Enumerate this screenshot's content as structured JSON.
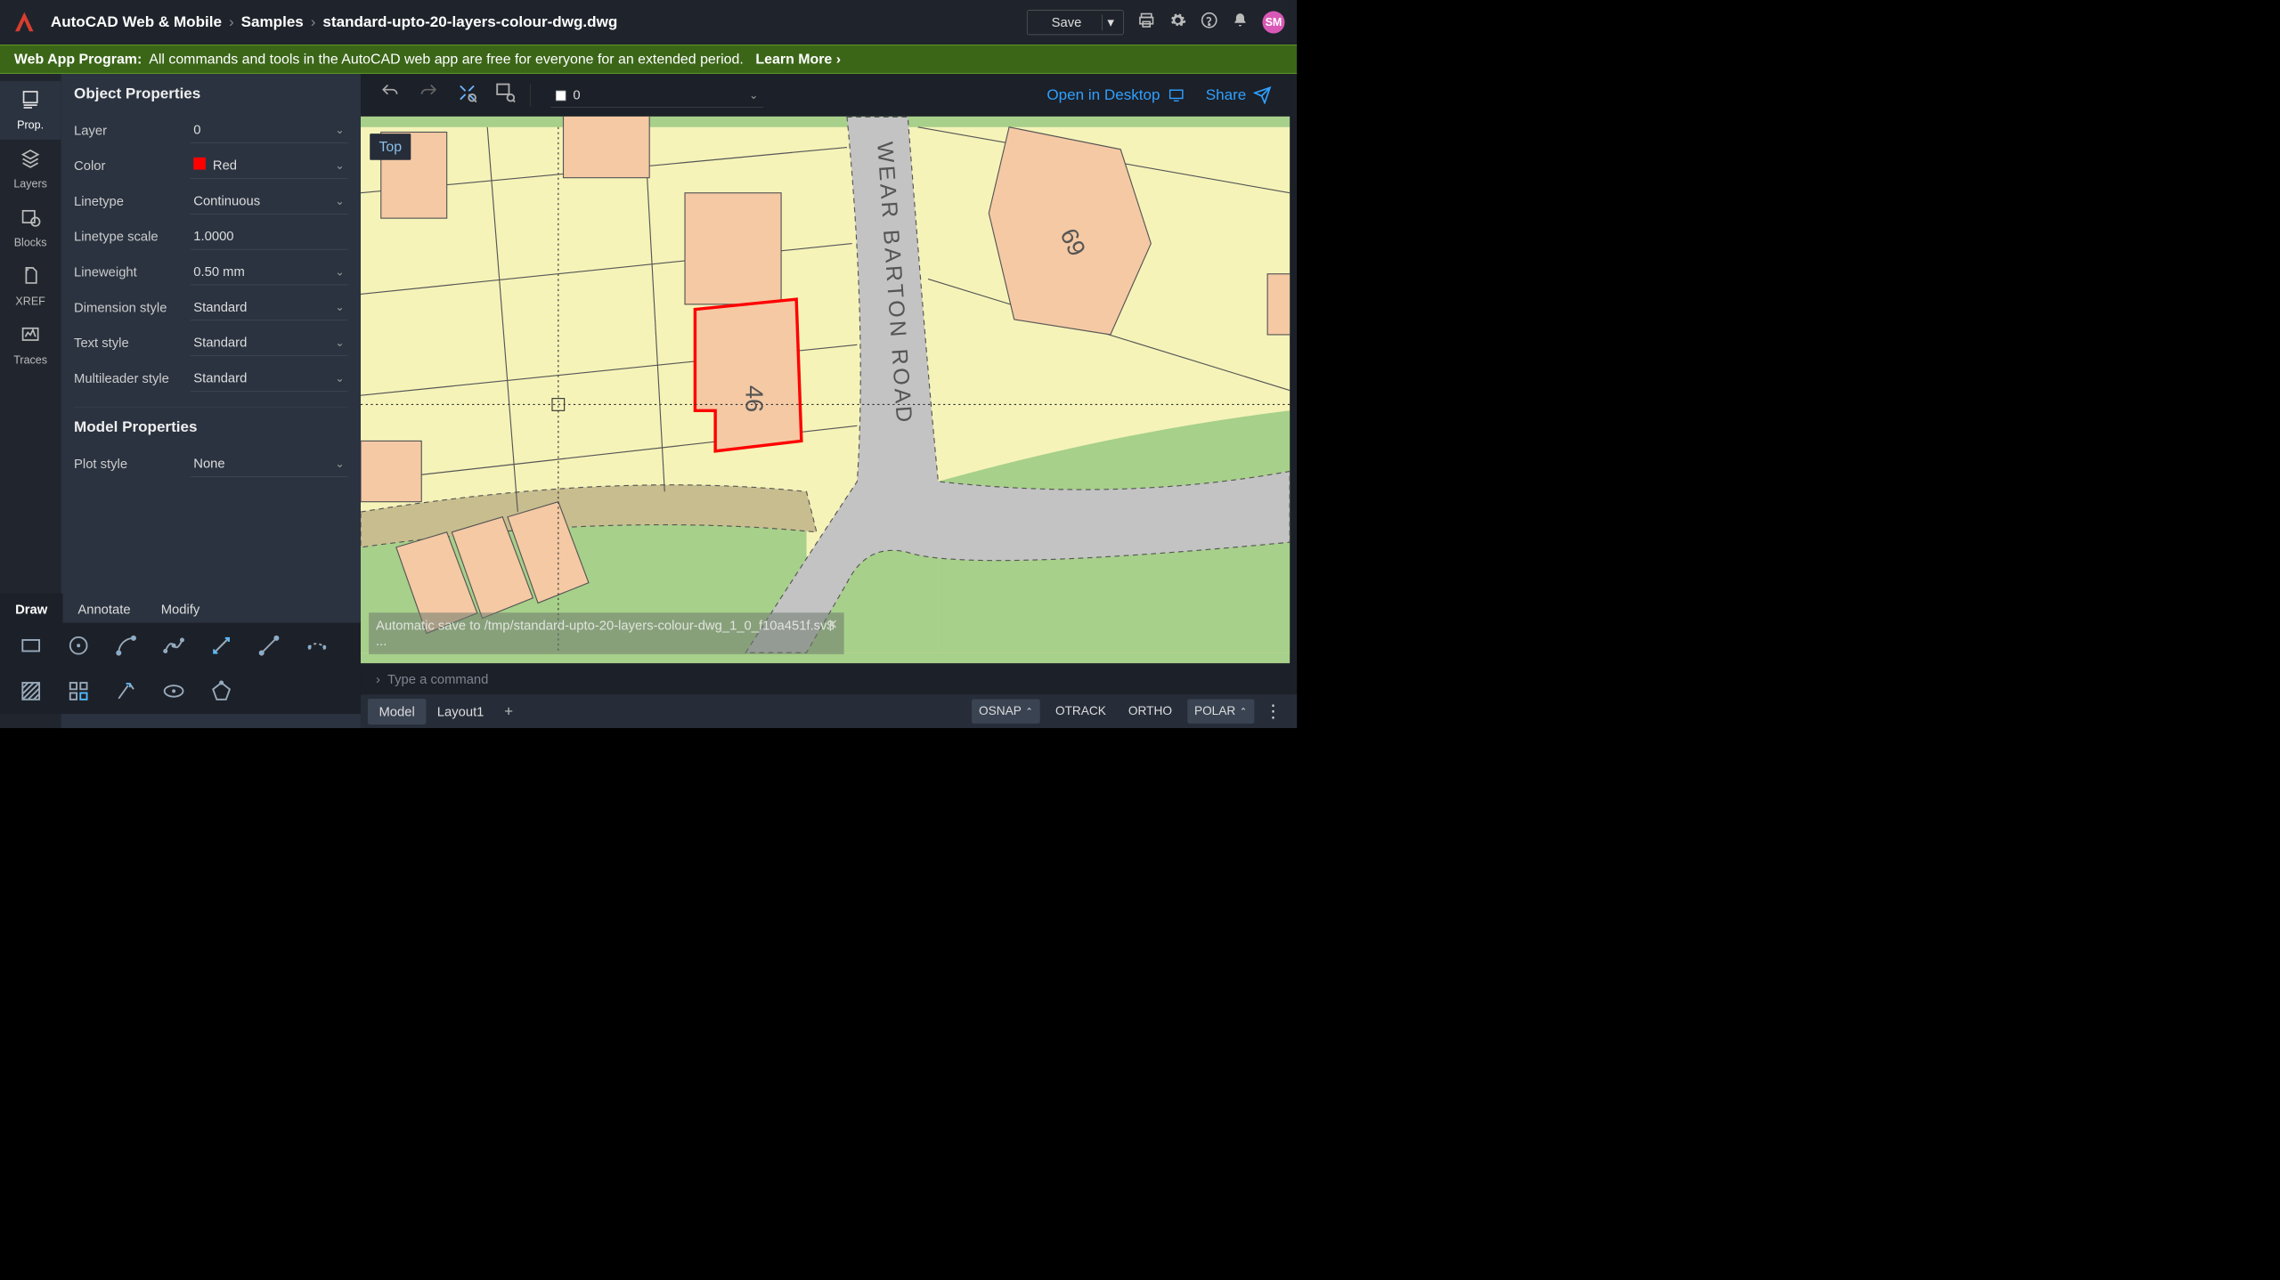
{
  "app": {
    "name": "AutoCAD Web & Mobile"
  },
  "breadcrumb": {
    "root": "AutoCAD Web & Mobile",
    "folder": "Samples",
    "file": "standard-upto-20-layers-colour-dwg.dwg"
  },
  "header": {
    "save": "Save",
    "avatar": "SM"
  },
  "banner": {
    "title": "Web App Program:",
    "body": "All commands and tools in the AutoCAD web app are free for everyone for an extended period.",
    "learn": "Learn More ›"
  },
  "rail": [
    {
      "id": "prop",
      "label": "Prop."
    },
    {
      "id": "layers",
      "label": "Layers"
    },
    {
      "id": "blocks",
      "label": "Blocks"
    },
    {
      "id": "xref",
      "label": "XREF"
    },
    {
      "id": "traces",
      "label": "Traces"
    }
  ],
  "props": {
    "object_title": "Object Properties",
    "rows": {
      "layer": {
        "label": "Layer",
        "value": "0"
      },
      "color": {
        "label": "Color",
        "value": "Red",
        "hex": "#ff0000"
      },
      "linetype": {
        "label": "Linetype",
        "value": "Continuous"
      },
      "ltscale": {
        "label": "Linetype scale",
        "value": "1.0000"
      },
      "lineweight": {
        "label": "Lineweight",
        "value": "0.50 mm"
      },
      "dimstyle": {
        "label": "Dimension style",
        "value": "Standard"
      },
      "textstyle": {
        "label": "Text style",
        "value": "Standard"
      },
      "mlstyle": {
        "label": "Multileader style",
        "value": "Standard"
      }
    },
    "model_title": "Model Properties",
    "plotstyle": {
      "label": "Plot style",
      "value": "None"
    }
  },
  "toolTabs": {
    "draw": "Draw",
    "annotate": "Annotate",
    "modify": "Modify"
  },
  "canvas": {
    "top_badge": "Top",
    "layer_dd": "0",
    "open_desktop": "Open in Desktop",
    "share": "Share",
    "autosave": "Automatic save to /tmp/standard-upto-20-layers-colour-dwg_1_0_f10a451f.sv$ ...",
    "road": "WEAR BARTON ROAD",
    "plot46": "46",
    "plot69": "69"
  },
  "cmdline": {
    "placeholder": "Type a command"
  },
  "bottomTabs": {
    "model": "Model",
    "layout1": "Layout1"
  },
  "toggles": {
    "osnap": "OSNAP",
    "otrack": "OTRACK",
    "ortho": "ORTHO",
    "polar": "POLAR"
  }
}
